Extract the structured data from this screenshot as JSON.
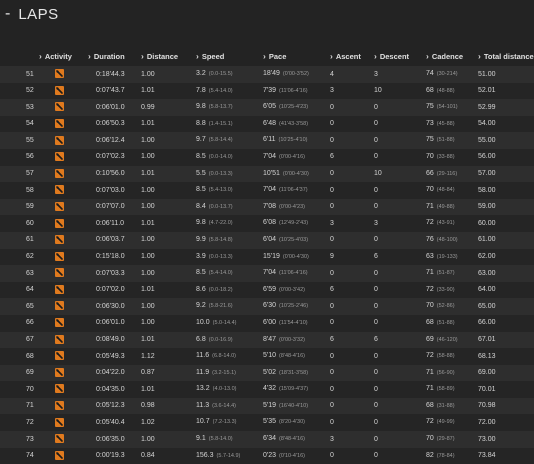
{
  "header": {
    "dash": "-",
    "title": "LAPS"
  },
  "columns": [
    {
      "label": "Activity"
    },
    {
      "label": "Duration"
    },
    {
      "label": "Distance"
    },
    {
      "label": "Speed"
    },
    {
      "label": "Pace"
    },
    {
      "label": "Ascent"
    },
    {
      "label": "Descent"
    },
    {
      "label": "Cadence"
    },
    {
      "label": "Total distance"
    }
  ],
  "rows": [
    {
      "lap": "51",
      "duration": "0:18'44.3",
      "distance": "1.00",
      "speed": "3.2",
      "speed_range": "(0.0-15.5)",
      "pace": "18'49",
      "pace_range": "(0'00-3'52)",
      "ascent": "4",
      "descent": "3",
      "cadence": "74",
      "cadence_range": "(30-214)",
      "total": "51.00"
    },
    {
      "lap": "52",
      "duration": "0:07'43.7",
      "distance": "1.01",
      "speed": "7.8",
      "speed_range": "(5.4-14.0)",
      "pace": "7'39",
      "pace_range": "(11'06-4'16)",
      "ascent": "3",
      "descent": "10",
      "cadence": "68",
      "cadence_range": "(48-88)",
      "total": "52.01"
    },
    {
      "lap": "53",
      "duration": "0:06'01.0",
      "distance": "0.99",
      "speed": "9.8",
      "speed_range": "(5.8-13.7)",
      "pace": "6'05",
      "pace_range": "(10'25-4'23)",
      "ascent": "0",
      "descent": "0",
      "cadence": "75",
      "cadence_range": "(54-101)",
      "total": "52.99"
    },
    {
      "lap": "54",
      "duration": "0:06'50.3",
      "distance": "1.01",
      "speed": "8.8",
      "speed_range": "(1.4-15.1)",
      "pace": "6'48",
      "pace_range": "(41'43-3'58)",
      "ascent": "0",
      "descent": "0",
      "cadence": "73",
      "cadence_range": "(45-88)",
      "total": "54.00"
    },
    {
      "lap": "55",
      "duration": "0:06'12.4",
      "distance": "1.00",
      "speed": "9.7",
      "speed_range": "(5.8-14.4)",
      "pace": "6'11",
      "pace_range": "(10'25-4'10)",
      "ascent": "0",
      "descent": "0",
      "cadence": "75",
      "cadence_range": "(51-88)",
      "total": "55.00"
    },
    {
      "lap": "56",
      "duration": "0:07'02.3",
      "distance": "1.00",
      "speed": "8.5",
      "speed_range": "(0.0-14.0)",
      "pace": "7'04",
      "pace_range": "(0'00-4'16)",
      "ascent": "6",
      "descent": "0",
      "cadence": "70",
      "cadence_range": "(33-88)",
      "total": "56.00"
    },
    {
      "lap": "57",
      "duration": "0:10'56.0",
      "distance": "1.01",
      "speed": "5.5",
      "speed_range": "(0.0-13.3)",
      "pace": "10'51",
      "pace_range": "(0'00-4'30)",
      "ascent": "0",
      "descent": "10",
      "cadence": "66",
      "cadence_range": "(29-116)",
      "total": "57.00"
    },
    {
      "lap": "58",
      "duration": "0:07'03.0",
      "distance": "1.00",
      "speed": "8.5",
      "speed_range": "(5.4-13.0)",
      "pace": "7'04",
      "pace_range": "(11'06-4'37)",
      "ascent": "0",
      "descent": "0",
      "cadence": "70",
      "cadence_range": "(48-84)",
      "total": "58.00"
    },
    {
      "lap": "59",
      "duration": "0:07'07.0",
      "distance": "1.00",
      "speed": "8.4",
      "speed_range": "(0.0-13.7)",
      "pace": "7'08",
      "pace_range": "(0'00-4'23)",
      "ascent": "0",
      "descent": "0",
      "cadence": "71",
      "cadence_range": "(49-88)",
      "total": "59.00"
    },
    {
      "lap": "60",
      "duration": "0:06'11.0",
      "distance": "1.01",
      "speed": "9.8",
      "speed_range": "(4.7-22.0)",
      "pace": "6'08",
      "pace_range": "(12'49-2'43)",
      "ascent": "3",
      "descent": "3",
      "cadence": "72",
      "cadence_range": "(43-91)",
      "total": "60.00"
    },
    {
      "lap": "61",
      "duration": "0:06'03.7",
      "distance": "1.00",
      "speed": "9.9",
      "speed_range": "(5.8-14.8)",
      "pace": "6'04",
      "pace_range": "(10'25-4'03)",
      "ascent": "0",
      "descent": "0",
      "cadence": "76",
      "cadence_range": "(48-100)",
      "total": "61.00"
    },
    {
      "lap": "62",
      "duration": "0:15'18.0",
      "distance": "1.00",
      "speed": "3.9",
      "speed_range": "(0.0-13.3)",
      "pace": "15'19",
      "pace_range": "(0'00-4'30)",
      "ascent": "9",
      "descent": "6",
      "cadence": "63",
      "cadence_range": "(19-133)",
      "total": "62.00"
    },
    {
      "lap": "63",
      "duration": "0:07'03.3",
      "distance": "1.00",
      "speed": "8.5",
      "speed_range": "(5.4-14.0)",
      "pace": "7'04",
      "pace_range": "(11'06-4'16)",
      "ascent": "0",
      "descent": "0",
      "cadence": "71",
      "cadence_range": "(51-87)",
      "total": "63.00"
    },
    {
      "lap": "64",
      "duration": "0:07'02.0",
      "distance": "1.01",
      "speed": "8.6",
      "speed_range": "(0.0-18.2)",
      "pace": "6'59",
      "pace_range": "(0'00-3'42)",
      "ascent": "6",
      "descent": "0",
      "cadence": "72",
      "cadence_range": "(33-90)",
      "total": "64.00"
    },
    {
      "lap": "65",
      "duration": "0:06'30.0",
      "distance": "1.00",
      "speed": "9.2",
      "speed_range": "(5.8-21.6)",
      "pace": "6'30",
      "pace_range": "(10'25-2'46)",
      "ascent": "0",
      "descent": "0",
      "cadence": "70",
      "cadence_range": "(52-86)",
      "total": "65.00"
    },
    {
      "lap": "66",
      "duration": "0:06'01.0",
      "distance": "1.00",
      "speed": "10.0",
      "speed_range": "(5.0-14.4)",
      "pace": "6'00",
      "pace_range": "(11'54-4'10)",
      "ascent": "0",
      "descent": "0",
      "cadence": "68",
      "cadence_range": "(51-88)",
      "total": "66.00"
    },
    {
      "lap": "67",
      "duration": "0:08'49.0",
      "distance": "1.01",
      "speed": "6.8",
      "speed_range": "(0.0-16.9)",
      "pace": "8'47",
      "pace_range": "(0'00-3'32)",
      "ascent": "6",
      "descent": "6",
      "cadence": "69",
      "cadence_range": "(46-120)",
      "total": "67.01"
    },
    {
      "lap": "68",
      "duration": "0:05'49.3",
      "distance": "1.12",
      "speed": "11.6",
      "speed_range": "(6.8-14.0)",
      "pace": "5'10",
      "pace_range": "(8'48-4'16)",
      "ascent": "0",
      "descent": "0",
      "cadence": "72",
      "cadence_range": "(58-88)",
      "total": "68.13"
    },
    {
      "lap": "69",
      "duration": "0:04'22.0",
      "distance": "0.87",
      "speed": "11.9",
      "speed_range": "(3.2-15.1)",
      "pace": "5'02",
      "pace_range": "(18'31-3'58)",
      "ascent": "0",
      "descent": "0",
      "cadence": "71",
      "cadence_range": "(56-90)",
      "total": "69.00"
    },
    {
      "lap": "70",
      "duration": "0:04'35.0",
      "distance": "1.01",
      "speed": "13.2",
      "speed_range": "(4.0-13.0)",
      "pace": "4'32",
      "pace_range": "(15'09-4'37)",
      "ascent": "0",
      "descent": "0",
      "cadence": "71",
      "cadence_range": "(58-89)",
      "total": "70.01"
    },
    {
      "lap": "71",
      "duration": "0:05'12.3",
      "distance": "0.98",
      "speed": "11.3",
      "speed_range": "(3.6-14.4)",
      "pace": "5'19",
      "pace_range": "(16'40-4'10)",
      "ascent": "0",
      "descent": "0",
      "cadence": "68",
      "cadence_range": "(31-88)",
      "total": "70.98"
    },
    {
      "lap": "72",
      "duration": "0:05'40.4",
      "distance": "1.02",
      "speed": "10.7",
      "speed_range": "(7.2-13.3)",
      "pace": "5'35",
      "pace_range": "(8'20-4'30)",
      "ascent": "0",
      "descent": "0",
      "cadence": "72",
      "cadence_range": "(49-99)",
      "total": "72.00"
    },
    {
      "lap": "73",
      "duration": "0:06'35.0",
      "distance": "1.00",
      "speed": "9.1",
      "speed_range": "(5.8-14.0)",
      "pace": "6'34",
      "pace_range": "(8'48-4'16)",
      "ascent": "3",
      "descent": "0",
      "cadence": "70",
      "cadence_range": "(29-87)",
      "total": "73.00"
    },
    {
      "lap": "74",
      "duration": "0:00'19.3",
      "distance": "0.84",
      "speed": "156.3",
      "speed_range": "(5.7-14.9)",
      "pace": "0'23",
      "pace_range": "(0'10-4'16)",
      "ascent": "0",
      "descent": "0",
      "cadence": "82",
      "cadence_range": "(78-84)",
      "total": "73.84"
    }
  ]
}
